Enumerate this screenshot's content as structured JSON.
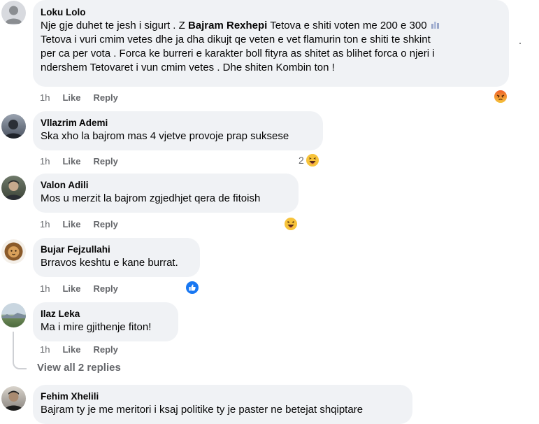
{
  "comments": [
    {
      "author": "Loku Lolo",
      "text": "Nje gje duhet te jesh i sigurt . Z",
      "mention": "Bajram Rexhepi",
      "lines": [
        "Tetova e shiti voten me 200 e 300",
        "Tetova i vuri cmim vetes dhe ja dha dikujt qe veten e vet flamurin ton e shiti te shkint",
        "per ca per vota . Forca ke burreri e karakter boll fityra as shitet as blihet forca o njeri i",
        "ndershem Tetovaret i vun cmim vetes . Dhe shiten Kombin ton !"
      ],
      "time": "1h",
      "like": "Like",
      "reply": "Reply",
      "reaction_icon": "angry-reaction-icon"
    },
    {
      "author": "Vllazrim Ademi",
      "text": "Ska xho la bajrom mas 4 vjetve provoje prap suksese",
      "time": "1h",
      "like": "Like",
      "reply": "Reply",
      "reaction_count": "2",
      "reaction_icon": "haha-reaction-icon"
    },
    {
      "author": "Valon Adili",
      "text": "Mos u merzit la bajrom zgjedhjet qera de fitoish",
      "time": "1h",
      "like": "Like",
      "reply": "Reply",
      "reaction_icon": "haha-reaction-icon"
    },
    {
      "author": "Bujar Fejzullahi",
      "text": "Brravos keshtu e kane burrat.",
      "time": "1h",
      "like": "Like",
      "reply": "Reply",
      "reaction_icon": "like-reaction-icon"
    },
    {
      "author": "Ilaz Leka",
      "text": "Ma i mire gjithenje fiton!",
      "time": "1h",
      "like": "Like",
      "reply": "Reply"
    },
    {
      "author": "Fehim Xhelili",
      "text": "Bajram ty je me meritori i ksaj politike ty je paster ne betejat shqiptare"
    }
  ],
  "view_replies": "View all 2 replies",
  "colors": {
    "bubble": "#f0f2f5",
    "meta": "#65676b",
    "like_blue": "#1877f2",
    "haha_yellow": "#f7b125",
    "angry_red": "#e9710f"
  }
}
